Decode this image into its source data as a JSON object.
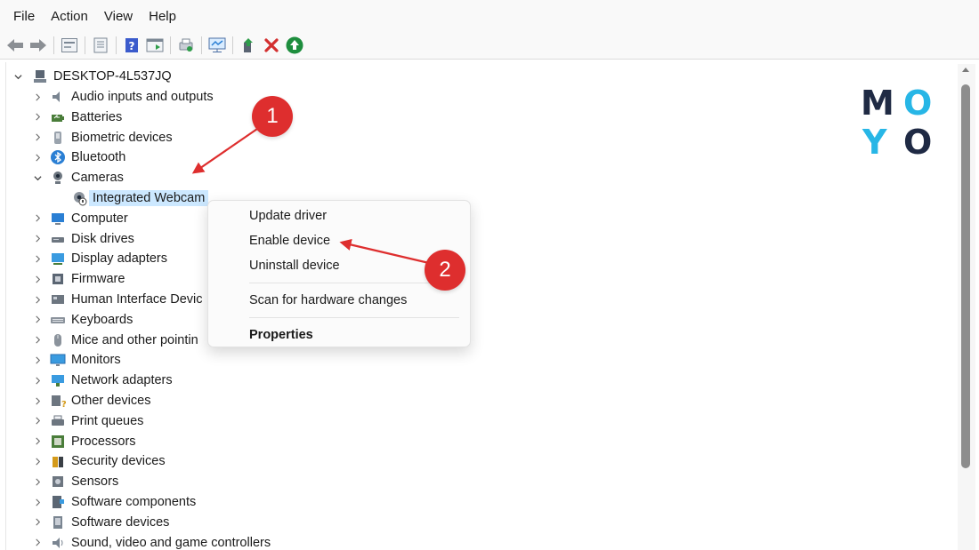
{
  "menu": {
    "items": [
      "File",
      "Action",
      "View",
      "Help"
    ]
  },
  "toolbar": {
    "buttons": [
      "back-icon",
      "forward-icon",
      "show-hide-tree-icon",
      "properties-icon",
      "help-icon",
      "action-pane-icon",
      "print-icon",
      "scan-monitor-icon",
      "update-driver-icon",
      "uninstall-x-icon",
      "enable-arrow-icon"
    ],
    "colors": {
      "uninstall": "#d32f2f",
      "enable": "#1e8e3e"
    }
  },
  "tree": {
    "root": "DESKTOP-4L537JQ",
    "items": [
      {
        "label": "Audio inputs and outputs",
        "icon": "speaker-icon"
      },
      {
        "label": "Batteries",
        "icon": "battery-icon"
      },
      {
        "label": "Biometric devices",
        "icon": "biometric-icon"
      },
      {
        "label": "Bluetooth",
        "icon": "bluetooth-icon"
      },
      {
        "label": "Cameras",
        "icon": "camera-icon",
        "expanded": true
      },
      {
        "label": "Integrated Webcam",
        "icon": "webcam-disabled-icon",
        "child": true,
        "selected": true
      },
      {
        "label": "Computer",
        "icon": "computer-icon"
      },
      {
        "label": "Disk drives",
        "icon": "disk-icon"
      },
      {
        "label": "Display adapters",
        "icon": "display-adapter-icon"
      },
      {
        "label": "Firmware",
        "icon": "firmware-icon"
      },
      {
        "label": "Human Interface Devic",
        "icon": "hid-icon"
      },
      {
        "label": "Keyboards",
        "icon": "keyboard-icon"
      },
      {
        "label": "Mice and other pointin",
        "icon": "mouse-icon"
      },
      {
        "label": "Monitors",
        "icon": "monitor-icon"
      },
      {
        "label": "Network adapters",
        "icon": "network-icon"
      },
      {
        "label": "Other devices",
        "icon": "other-devices-icon"
      },
      {
        "label": "Print queues",
        "icon": "printer-icon"
      },
      {
        "label": "Processors",
        "icon": "processor-icon"
      },
      {
        "label": "Security devices",
        "icon": "security-icon"
      },
      {
        "label": "Sensors",
        "icon": "sensor-icon"
      },
      {
        "label": "Software components",
        "icon": "software-component-icon"
      },
      {
        "label": "Software devices",
        "icon": "software-device-icon"
      },
      {
        "label": "Sound, video and game controllers",
        "icon": "sound-icon"
      }
    ]
  },
  "context_menu": {
    "update_driver": "Update driver",
    "enable_device": "Enable device",
    "uninstall_device": "Uninstall device",
    "scan_hardware": "Scan for hardware changes",
    "properties": "Properties"
  },
  "annotations": {
    "badge1": "1",
    "badge2": "2",
    "color": "#de2e2e"
  },
  "logo": {
    "letters": [
      "M",
      "O",
      "Y",
      "O"
    ],
    "colors": {
      "dark": "#1f2a44",
      "accent": "#27b6e6"
    }
  }
}
